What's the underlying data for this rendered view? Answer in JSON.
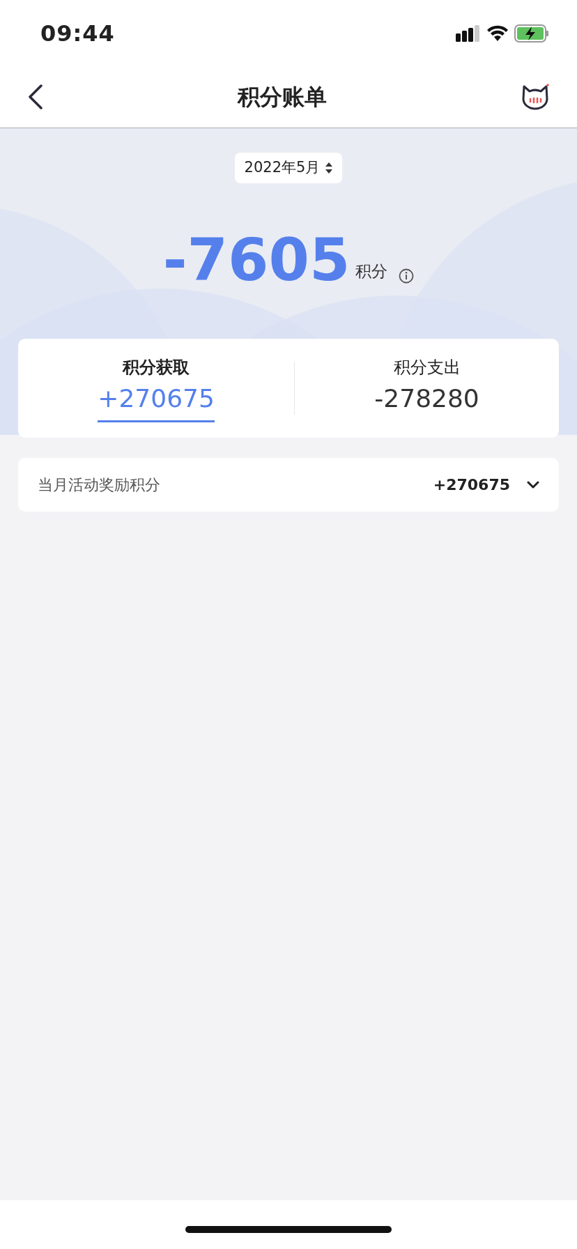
{
  "status_bar": {
    "time": "09:44"
  },
  "nav": {
    "title": "积分账单"
  },
  "month_picker": {
    "value": "2022年5月"
  },
  "balance": {
    "amount": "-7605",
    "unit": "积分"
  },
  "tabs": [
    {
      "label": "积分获取",
      "amount": "+270675",
      "selected": true
    },
    {
      "label": "积分支出",
      "amount": "-278280",
      "selected": false
    }
  ],
  "entries": [
    {
      "label": "当月活动奖励积分",
      "amount": "+270675",
      "expanded": false
    }
  ]
}
